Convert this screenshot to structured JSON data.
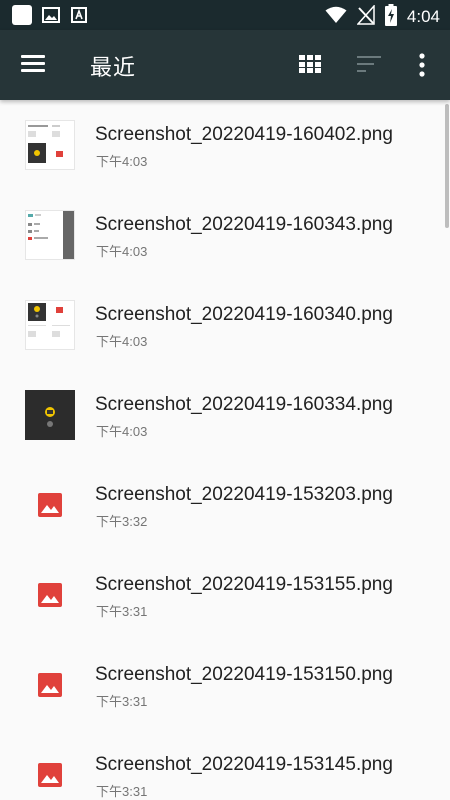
{
  "status_bar": {
    "time": "4:04",
    "left_icons": [
      "app-icon",
      "image-icon",
      "font-icon"
    ],
    "right_icons": [
      "wifi-icon",
      "no-signal-icon",
      "battery-charging-icon"
    ]
  },
  "toolbar": {
    "title": "最近",
    "actions": [
      "menu-icon",
      "grid-view-icon",
      "sort-icon",
      "more-vert-icon"
    ]
  },
  "files": [
    {
      "name": "Screenshot_20220419-160402.png",
      "time": "下午4:03",
      "thumb": "screenshot-light"
    },
    {
      "name": "Screenshot_20220419-160343.png",
      "time": "下午4:03",
      "thumb": "screenshot-light-panel"
    },
    {
      "name": "Screenshot_20220419-160340.png",
      "time": "下午4:03",
      "thumb": "screenshot-light"
    },
    {
      "name": "Screenshot_20220419-160334.png",
      "time": "下午4:03",
      "thumb": "screenshot-dark"
    },
    {
      "name": "Screenshot_20220419-153203.png",
      "time": "下午3:32",
      "thumb": "image-icon"
    },
    {
      "name": "Screenshot_20220419-153155.png",
      "time": "下午3:31",
      "thumb": "image-icon"
    },
    {
      "name": "Screenshot_20220419-153150.png",
      "time": "下午3:31",
      "thumb": "image-icon"
    },
    {
      "name": "Screenshot_20220419-153145.png",
      "time": "下午3:31",
      "thumb": "image-icon"
    }
  ],
  "colors": {
    "status_bar": "#1b2a2e",
    "toolbar": "#263538",
    "image_icon": "#e0413b",
    "background": "#fafafa"
  }
}
